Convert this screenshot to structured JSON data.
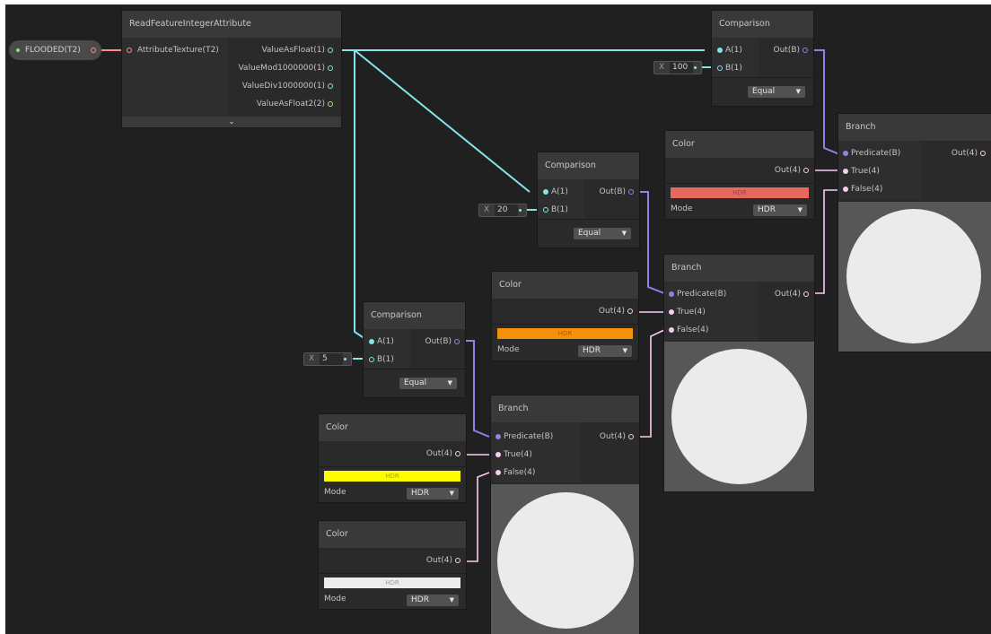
{
  "property": {
    "label": "FLOODED(T2)"
  },
  "read_node": {
    "title": "ReadFeatureIntegerAttribute",
    "input": "AttributeTexture(T2)",
    "outputs": [
      "ValueAsFloat(1)",
      "ValueMod1000000(1)",
      "ValueDiv1000000(1)",
      "ValueAsFloat2(2)"
    ],
    "expand_icon": "chevron-down-icon"
  },
  "comparison_nodes": [
    {
      "title": "Comparison",
      "in_a": "A(1)",
      "in_b": "B(1)",
      "out": "Out(B)",
      "x_label": "X",
      "b_value": "100",
      "mode": "Equal"
    },
    {
      "title": "Comparison",
      "in_a": "A(1)",
      "in_b": "B(1)",
      "out": "Out(B)",
      "x_label": "X",
      "b_value": "20",
      "mode": "Equal"
    },
    {
      "title": "Comparison",
      "in_a": "A(1)",
      "in_b": "B(1)",
      "out": "Out(B)",
      "x_label": "X",
      "b_value": "5",
      "mode": "Equal"
    }
  ],
  "color_nodes": [
    {
      "title": "Color",
      "out": "Out(4)",
      "swatch_color": "#e8675f",
      "swatch_label": "HDR",
      "mode_label": "Mode",
      "mode_value": "HDR"
    },
    {
      "title": "Color",
      "out": "Out(4)",
      "swatch_color": "#f5900a",
      "swatch_label": "HDR",
      "mode_label": "Mode",
      "mode_value": "HDR"
    },
    {
      "title": "Color",
      "out": "Out(4)",
      "swatch_color": "#fdfd00",
      "swatch_label": "HDR",
      "mode_label": "Mode",
      "mode_value": "HDR"
    },
    {
      "title": "Color",
      "out": "Out(4)",
      "swatch_color": "#ececec",
      "swatch_label": "HDR",
      "mode_label": "Mode",
      "mode_value": "HDR"
    }
  ],
  "branch_nodes": [
    {
      "title": "Branch",
      "predicate": "Predicate(B)",
      "true_in": "True(4)",
      "false_in": "False(4)",
      "out": "Out(4)"
    },
    {
      "title": "Branch",
      "predicate": "Predicate(B)",
      "true_in": "True(4)",
      "false_in": "False(4)",
      "out": "Out(4)"
    },
    {
      "title": "Branch",
      "predicate": "Predicate(B)",
      "true_in": "True(4)",
      "false_in": "False(4)",
      "out": "Out(4)"
    }
  ],
  "colors": {
    "float_port": "#84e4e7",
    "bool_port": "#9481e6",
    "vector4_port": "#fbcbf4",
    "texture_port": "#ff8b8b",
    "dropdown_arrow": "▼"
  }
}
